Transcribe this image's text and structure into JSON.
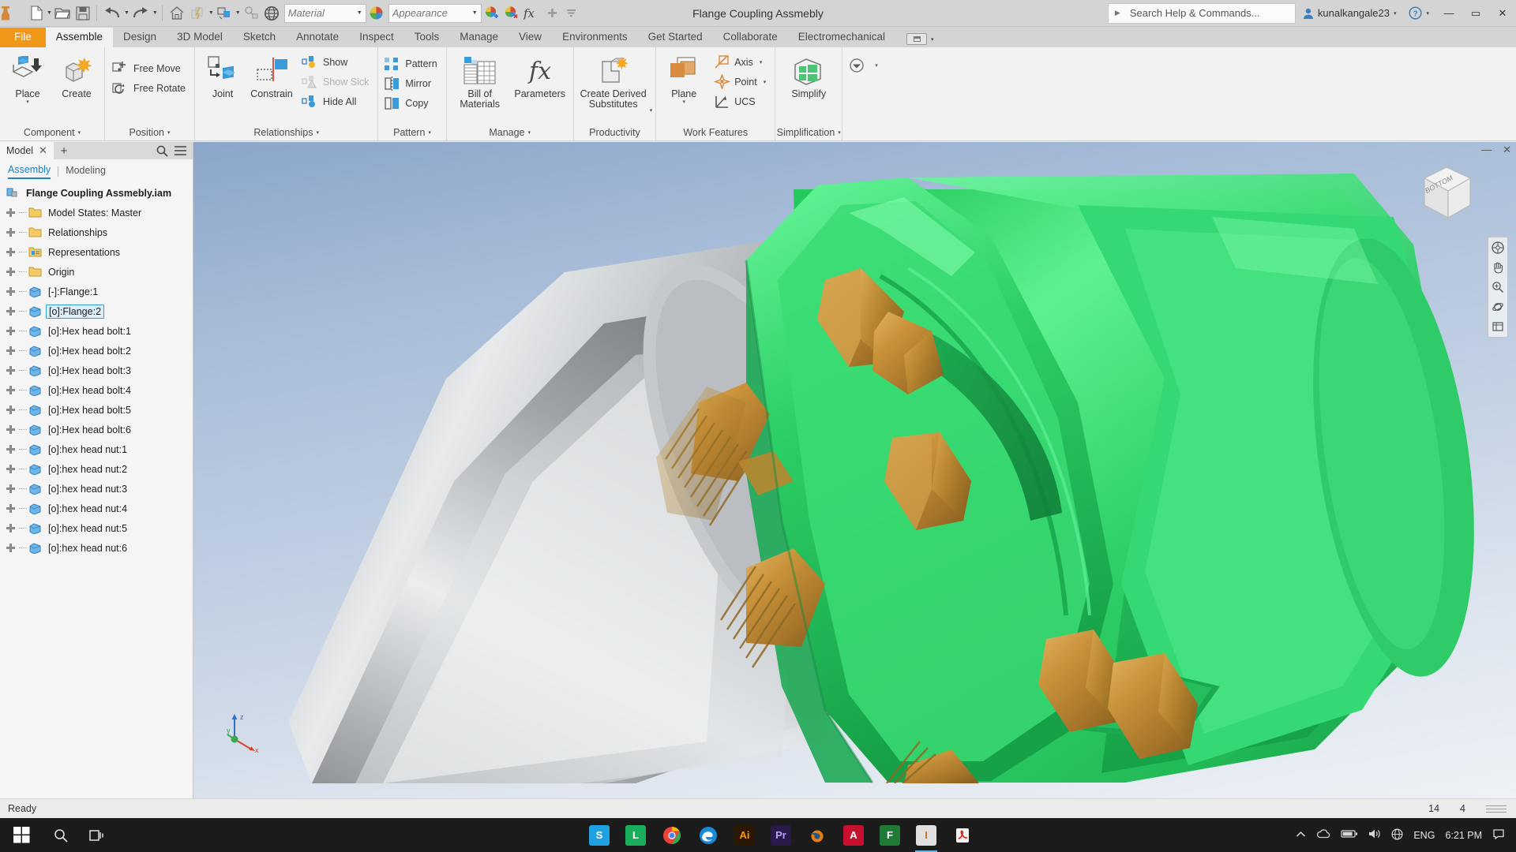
{
  "window": {
    "document_title": "Flange Coupling Assmebly",
    "minimize_label": "—",
    "maximize_label": "▭",
    "close_label": "✕"
  },
  "quick_access": {
    "logo": "inventor-logo-icon",
    "buttons": [
      {
        "name": "new-file",
        "icon": "new-document-icon",
        "caret": true
      },
      {
        "name": "open-file",
        "icon": "open-folder-icon",
        "caret": false
      },
      {
        "name": "save-file",
        "icon": "save-disk-icon",
        "caret": false
      },
      {
        "name": "undo",
        "icon": "undo-arrow-icon",
        "caret": true
      },
      {
        "name": "redo",
        "icon": "redo-arrow-icon",
        "caret": true
      },
      {
        "name": "return-home",
        "icon": "home-icon",
        "caret": false
      },
      {
        "name": "update",
        "icon": "update-icon",
        "caret": true
      },
      {
        "name": "select-mode",
        "icon": "select-box-icon",
        "caret": true
      },
      {
        "name": "measure",
        "icon": "measure-icon",
        "caret": false
      },
      {
        "name": "shadows",
        "icon": "globe-mesh-icon",
        "caret": false
      }
    ],
    "material_value": "Material",
    "appearance_value": "Appearance",
    "extra_buttons": [
      {
        "name": "adjust-appearance",
        "icon": "appearance-add-icon"
      },
      {
        "name": "clear-appearance",
        "icon": "appearance-remove-icon"
      },
      {
        "name": "parameters-fx",
        "icon": "fx-icon"
      },
      {
        "name": "customize-qat-add",
        "icon": "plus-icon"
      },
      {
        "name": "customize-qat-menu",
        "icon": "chevron-down-icon"
      }
    ]
  },
  "search": {
    "placeholder": "Search Help & Commands...",
    "arrow": "▶"
  },
  "account": {
    "user_name": "kunalkangale23",
    "caret": "▾",
    "help_label": "?",
    "help_caret": "▾"
  },
  "ribbon_tabs": [
    {
      "label": "File",
      "style": "file"
    },
    {
      "label": "Assemble",
      "style": "active"
    },
    {
      "label": "Design",
      "style": "normal"
    },
    {
      "label": "3D Model",
      "style": "normal"
    },
    {
      "label": "Sketch",
      "style": "normal"
    },
    {
      "label": "Annotate",
      "style": "normal"
    },
    {
      "label": "Inspect",
      "style": "normal"
    },
    {
      "label": "Tools",
      "style": "normal"
    },
    {
      "label": "Manage",
      "style": "normal"
    },
    {
      "label": "View",
      "style": "normal"
    },
    {
      "label": "Environments",
      "style": "normal"
    },
    {
      "label": "Get Started",
      "style": "normal"
    },
    {
      "label": "Collaborate",
      "style": "normal"
    },
    {
      "label": "Electromechanical",
      "style": "normal"
    }
  ],
  "ribbon_panels": {
    "component": {
      "label": "Component",
      "caret": "▾",
      "place": {
        "label": "Place",
        "caret": "▾"
      },
      "create": {
        "label": "Create"
      }
    },
    "position": {
      "label": "Position",
      "caret": "▾",
      "free_move": "Free Move",
      "free_rotate": "Free Rotate"
    },
    "relationships": {
      "label": "Relationships",
      "caret": "▾",
      "joint": "Joint",
      "constrain": "Constrain",
      "show": "Show",
      "show_sick": "Show Sick",
      "hide_all": "Hide All"
    },
    "pattern": {
      "label": "Pattern",
      "caret": "▾",
      "pattern": "Pattern",
      "mirror": "Mirror",
      "copy": "Copy"
    },
    "manage": {
      "label": "Manage",
      "caret": "▾",
      "bom_line1": "Bill of",
      "bom_line2": "Materials",
      "parameters": "Parameters"
    },
    "productivity": {
      "label": "Productivity",
      "derived_line1": "Create Derived",
      "derived_line2": "Substitutes",
      "caret": "▾"
    },
    "work_features": {
      "label": "Work Features",
      "plane": "Plane",
      "plane_caret": "▾",
      "axis": "Axis",
      "axis_caret": "▾",
      "point": "Point",
      "point_caret": "▾",
      "ucs": "UCS"
    },
    "simplification": {
      "label": "Simplification",
      "caret": "▾",
      "simplify": "Simplify"
    },
    "convert": {
      "caret": "▾"
    }
  },
  "browser": {
    "tab_label": "Model",
    "tab_close": "✕",
    "add_tab": "+",
    "search_icon": "search-icon",
    "menu_icon": "hamburger-menu-icon",
    "filters": [
      {
        "label": "Assembly",
        "active": true
      },
      {
        "label": "Modeling",
        "active": false
      }
    ],
    "root": {
      "label": "Flange Coupling Assmebly.iam",
      "icon": "assembly-icon"
    },
    "nodes": [
      {
        "label": "Model States: Master",
        "icon": "folder-icon",
        "selected": false
      },
      {
        "label": "Relationships",
        "icon": "folder-icon",
        "selected": false
      },
      {
        "label": "Representations",
        "icon": "folder-rep-icon",
        "selected": false
      },
      {
        "label": "Origin",
        "icon": "folder-icon",
        "selected": false
      },
      {
        "label": "[-]:Flange:1",
        "icon": "part-icon",
        "selected": false
      },
      {
        "label": "[o]:Flange:2",
        "icon": "part-icon",
        "selected": true
      },
      {
        "label": "[o]:Hex head bolt:1",
        "icon": "part-icon",
        "selected": false
      },
      {
        "label": "[o]:Hex head bolt:2",
        "icon": "part-icon",
        "selected": false
      },
      {
        "label": "[o]:Hex head bolt:3",
        "icon": "part-icon",
        "selected": false
      },
      {
        "label": "[o]:Hex head bolt:4",
        "icon": "part-icon",
        "selected": false
      },
      {
        "label": "[o]:Hex head bolt:5",
        "icon": "part-icon",
        "selected": false
      },
      {
        "label": "[o]:Hex head bolt:6",
        "icon": "part-icon",
        "selected": false
      },
      {
        "label": "[o]:hex head nut:1",
        "icon": "part-icon",
        "selected": false
      },
      {
        "label": "[o]:hex head nut:2",
        "icon": "part-icon",
        "selected": false
      },
      {
        "label": "[o]:hex head nut:3",
        "icon": "part-icon",
        "selected": false
      },
      {
        "label": "[o]:hex head nut:4",
        "icon": "part-icon",
        "selected": false
      },
      {
        "label": "[o]:hex head nut:5",
        "icon": "part-icon",
        "selected": false
      },
      {
        "label": "[o]:hex head nut:6",
        "icon": "part-icon",
        "selected": false
      }
    ]
  },
  "viewport": {
    "restore_label": "—",
    "close_label": "✕",
    "viewcube_face": "BOTTOM",
    "triad": {
      "x": "x",
      "y": "y",
      "z": "z"
    },
    "nav_tools": [
      {
        "name": "full-navigation-wheel-icon"
      },
      {
        "name": "pan-hand-icon"
      },
      {
        "name": "zoom-icon"
      },
      {
        "name": "orbit-icon"
      },
      {
        "name": "look-at-icon"
      }
    ],
    "colors": {
      "flange_green": "#3ad46c",
      "shaft_gray": "#b9bcbf",
      "bolt_gold": "#c9923a",
      "background_top": "#8ba6c9",
      "background_bottom": "#eef1f6"
    }
  },
  "doc_tabs": {
    "home_icon": "home-icon",
    "tabs": [
      {
        "label": "Flange Coupling Assmebly.iam",
        "close": "✕",
        "active": true
      }
    ]
  },
  "status_bar": {
    "ready": "Ready",
    "count_left": "14",
    "count_right": "4"
  },
  "taskbar": {
    "start_icon": "windows-start-icon",
    "search_icon": "search-icon",
    "task_view_icon": "task-view-icon",
    "apps": [
      {
        "name": "skype-icon",
        "glyph": "S",
        "color": "#1fa0e0"
      },
      {
        "name": "app-green-l-icon",
        "glyph": "L",
        "color": "#1aaf5d"
      },
      {
        "name": "chrome-icon",
        "glyph": "",
        "color": "#eb4335"
      },
      {
        "name": "edge-icon",
        "glyph": "",
        "color": "#2d8fe0"
      },
      {
        "name": "illustrator-icon",
        "glyph": "Ai",
        "color": "#ff9a00"
      },
      {
        "name": "premiere-icon",
        "glyph": "Pr",
        "color": "#9999ff"
      },
      {
        "name": "blender-icon",
        "glyph": "",
        "color": "#e87d0d"
      },
      {
        "name": "autocad-icon",
        "glyph": "A",
        "color": "#c8102e"
      },
      {
        "name": "fusion-icon",
        "glyph": "F",
        "color": "#2b9e3e"
      },
      {
        "name": "inventor-icon",
        "glyph": "I",
        "color": "#c8741e"
      },
      {
        "name": "acrobat-icon",
        "glyph": "",
        "color": "#e0261b"
      }
    ],
    "tray": {
      "show_hidden": "^",
      "onedrive_icon": "onedrive-icon",
      "battery_icon": "battery-icon",
      "volume_icon": "volume-icon",
      "network_icon": "network-icon",
      "keyboard_icon": "keyboard-icon",
      "language": "ENG",
      "time": "6:21 PM",
      "notification_icon": "notification-icon"
    }
  }
}
